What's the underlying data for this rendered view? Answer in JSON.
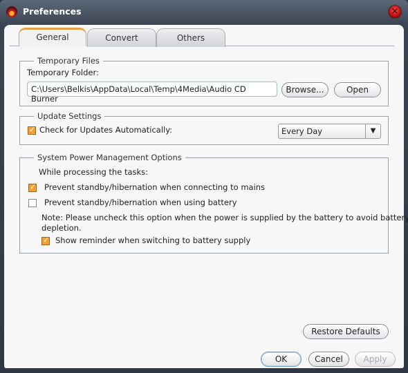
{
  "window": {
    "title": "Preferences"
  },
  "tabs": [
    {
      "label": "General",
      "active": true
    },
    {
      "label": "Convert"
    },
    {
      "label": "Others"
    }
  ],
  "temp": {
    "legend": "Temporary Files",
    "folder_label": "Temporary Folder:",
    "folder_value": "C:\\Users\\Belkis\\AppData\\Local\\Temp\\4Media\\Audio CD Burner",
    "browse": "Browse...",
    "open": "Open"
  },
  "update": {
    "legend": "Update Settings",
    "check_label": "Check for Updates Automatically:",
    "checked": true,
    "frequency": "Every Day"
  },
  "power": {
    "legend": "System Power Management Options",
    "intro": "While processing the tasks:",
    "mains": "Prevent standby/hibernation when connecting to mains",
    "mains_checked": true,
    "battery": "Prevent standby/hibernation when using battery",
    "battery_checked": false,
    "note1": "Note: Please uncheck this option when the power is supplied by the battery to avoid battery",
    "note2": "depletion.",
    "reminder": "Show reminder when switching to battery supply",
    "reminder_checked": true
  },
  "buttons": {
    "restore": "Restore Defaults",
    "ok": "OK",
    "cancel": "Cancel",
    "apply": "Apply"
  },
  "colors": {
    "accent": "#f2a030",
    "titlebar": "#3b4452"
  }
}
